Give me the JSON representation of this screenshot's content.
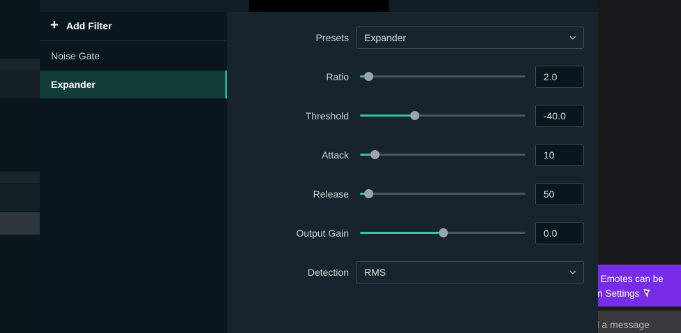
{
  "sidebar": {
    "add_filter_label": "Add Filter",
    "filters": [
      "Noise Gate",
      "Expander"
    ],
    "active_filter": "Expander"
  },
  "settings": {
    "presets": {
      "label": "Presets",
      "value": "Expander"
    },
    "ratio": {
      "label": "Ratio",
      "value": "2.0",
      "slider_fraction": 0.05
    },
    "threshold": {
      "label": "Threshold",
      "value": "-40.0",
      "slider_fraction": 0.33
    },
    "attack": {
      "label": "Attack",
      "value": "10",
      "slider_fraction": 0.09
    },
    "release": {
      "label": "Release",
      "value": "50",
      "slider_fraction": 0.05
    },
    "output_gain": {
      "label": "Output Gain",
      "value": "0.0",
      "slider_fraction": 0.5
    },
    "detection": {
      "label": "Detection",
      "value": "RMS"
    }
  },
  "chat": {
    "notice_line1": "ed Emotes can be",
    "notice_line2": "d in Settings",
    "input_placeholder": "nd a message"
  },
  "colors": {
    "accent": "#31c3a2",
    "chat_notice": "#772ce8"
  }
}
